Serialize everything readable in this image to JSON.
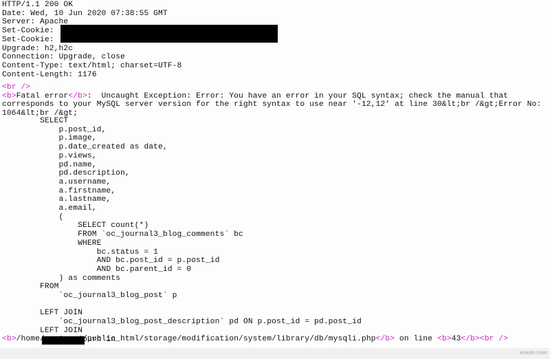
{
  "page": {
    "background": "#fdfdfd",
    "text_color": "#111111",
    "tag_color": "#cc22bb",
    "redaction_color": "#000000"
  },
  "http_headers": [
    "HTTP/1.1 200 OK",
    "Date: Wed, 10 Jun 2020 07:38:55 GMT",
    "Server: Apache",
    "Set-Cookie:",
    "Set-Cookie:",
    "Upgrade: h2,h2c",
    "Connection: Upgrade, close",
    "Content-Type: text/html; charset=UTF-8",
    "Content-Length: 1176"
  ],
  "error": {
    "br_open": "<br",
    "br_close": "/>",
    "b_open": "<b>",
    "b_close": "</b>",
    "fatal_label": "Fatal error",
    "message": ":  Uncaught Exception: Error: You have an error in your SQL syntax; check the manual that corresponds to your MySQL server version for the right syntax to use near '-12,12' at line 30&lt;br /&gt;Error No: 1064&lt;br /&gt;"
  },
  "sql_lines": [
    "        SELECT",
    "            p.post_id,",
    "            p.image,",
    "            p.date_created as date,",
    "            p.views,",
    "            pd.name,",
    "            pd.description,",
    "            a.username,",
    "            a.firstname,",
    "            a.lastname,",
    "            a.email,",
    "            (",
    "                SELECT count(*)",
    "                FROM `oc_journal3_blog_comments` bc",
    "                WHERE",
    "                    bc.status = 1",
    "                    AND bc.post_id = p.post_id",
    "                    AND bc.parent_id = 0",
    "            ) as comments",
    "        FROM",
    "            `oc_journal3_blog_post` p",
    "",
    "        LEFT JOIN",
    "            `oc_journal3_blog_post_description` pd ON p.post_id = pd.post_id",
    "        LEFT JOIN",
    "            `oc_journ in"
  ],
  "trace": {
    "b_open": "<b>",
    "b_close": "</b>",
    "path_prefix": "/home/",
    "path_suffix": "/public_html/storage/modification/system/library/db/mysqli.php",
    "on_line_label": " on line ",
    "line_number": "43",
    "br_open": "<br",
    "br_close": "/>"
  },
  "watermark": {
    "text": "wsxdn.com"
  }
}
